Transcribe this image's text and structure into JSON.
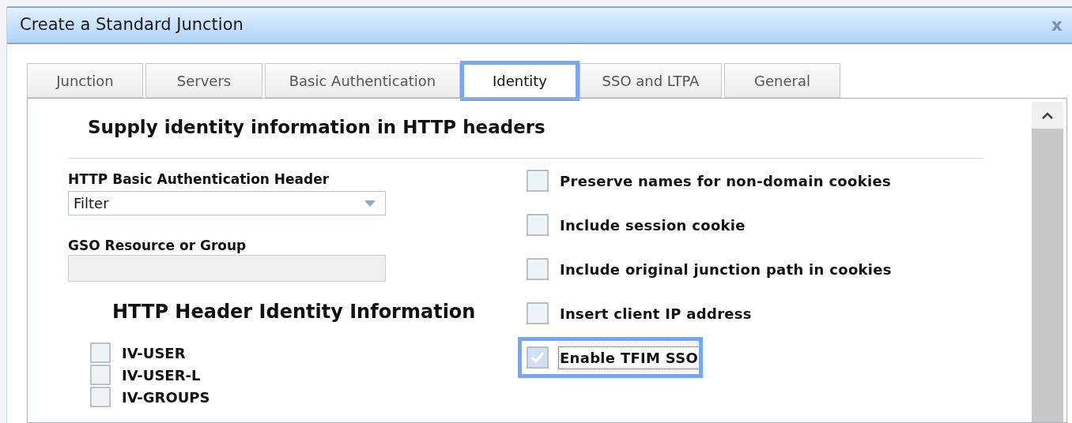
{
  "window": {
    "title": "Create a Standard Junction",
    "close": "x"
  },
  "tabs": [
    {
      "label": "Junction",
      "selected": false,
      "highlighted": false
    },
    {
      "label": "Servers",
      "selected": false,
      "highlighted": false
    },
    {
      "label": "Basic Authentication",
      "selected": false,
      "highlighted": false
    },
    {
      "label": "Identity",
      "selected": true,
      "highlighted": true
    },
    {
      "label": "SSO and LTPA",
      "selected": false,
      "highlighted": false
    },
    {
      "label": "General",
      "selected": false,
      "highlighted": false
    }
  ],
  "heading": "Supply identity information in HTTP headers",
  "basic_auth_header": {
    "label": "HTTP Basic Authentication Header",
    "value": "Filter"
  },
  "gso_resource": {
    "label": "GSO Resource or Group",
    "disabled": true
  },
  "identity_section": {
    "title": "HTTP Header Identity Information",
    "options": [
      {
        "label": "IV-USER",
        "checked": false
      },
      {
        "label": "IV-USER-L",
        "checked": false
      },
      {
        "label": "IV-GROUPS",
        "checked": false
      }
    ]
  },
  "options": [
    {
      "label": "Preserve names for non-domain cookies",
      "checked": false,
      "highlighted": false,
      "focused": false
    },
    {
      "label": "Include session cookie",
      "checked": false,
      "highlighted": false,
      "focused": false
    },
    {
      "label": "Include original junction path in cookies",
      "checked": false,
      "highlighted": false,
      "focused": false
    },
    {
      "label": "Insert client IP address",
      "checked": false,
      "highlighted": false,
      "focused": false
    },
    {
      "label": "Enable TFIM SSO",
      "checked": true,
      "highlighted": true,
      "focused": true
    }
  ]
}
